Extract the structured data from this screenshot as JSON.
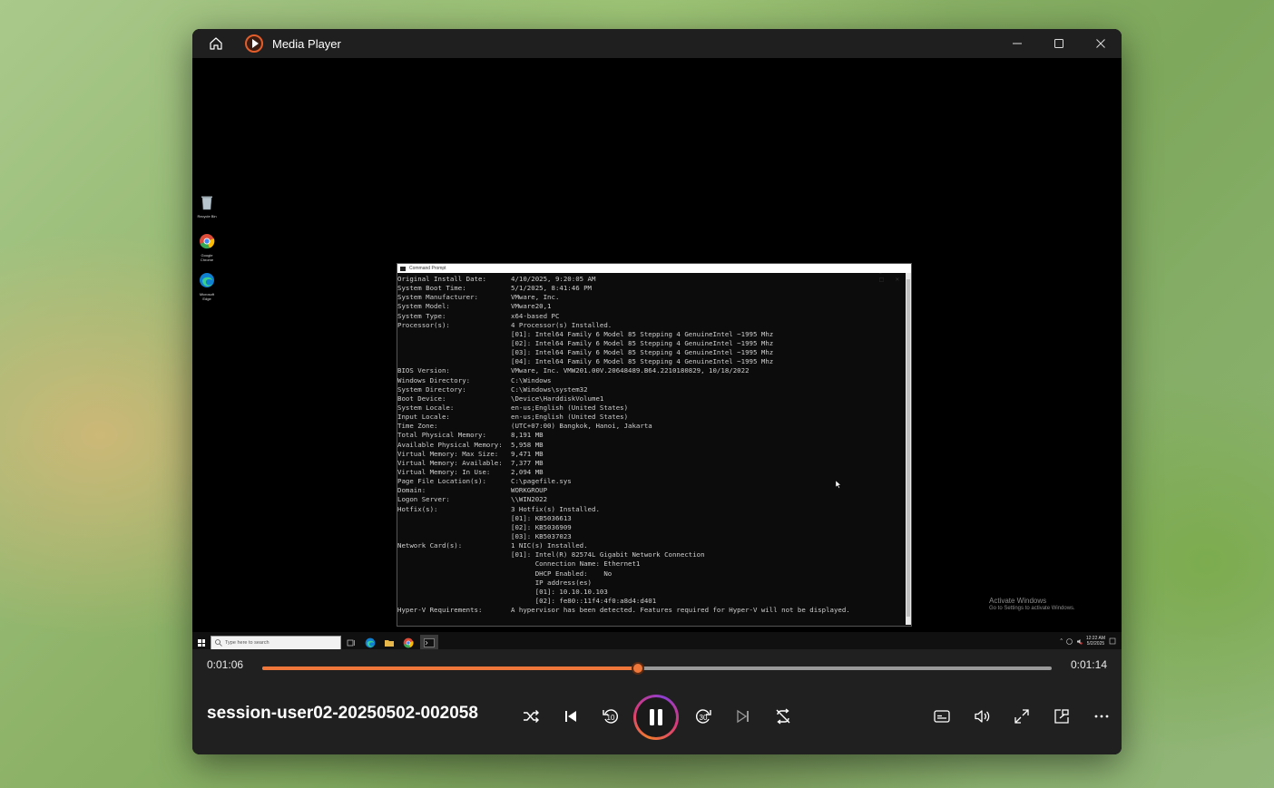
{
  "window": {
    "title": "Media Player"
  },
  "desktop": {
    "icons": [
      {
        "label": "Recycle Bin"
      },
      {
        "label": "Google Chrome"
      },
      {
        "label": "Microsoft Edge"
      }
    ],
    "cmd": {
      "title": "Command Prompt",
      "lines": [
        {
          "k": "Original Install Date:",
          "v": "4/10/2025, 9:20:05 AM"
        },
        {
          "k": "System Boot Time:",
          "v": "5/1/2025, 8:41:46 PM"
        },
        {
          "k": "System Manufacturer:",
          "v": "VMware, Inc."
        },
        {
          "k": "System Model:",
          "v": "VMware20,1"
        },
        {
          "k": "System Type:",
          "v": "x64-based PC"
        },
        {
          "k": "Processor(s):",
          "v": "4 Processor(s) Installed."
        },
        {
          "k": "",
          "v": "[01]: Intel64 Family 6 Model 85 Stepping 4 GenuineIntel ~1995 Mhz"
        },
        {
          "k": "",
          "v": "[02]: Intel64 Family 6 Model 85 Stepping 4 GenuineIntel ~1995 Mhz"
        },
        {
          "k": "",
          "v": "[03]: Intel64 Family 6 Model 85 Stepping 4 GenuineIntel ~1995 Mhz"
        },
        {
          "k": "",
          "v": "[04]: Intel64 Family 6 Model 85 Stepping 4 GenuineIntel ~1995 Mhz"
        },
        {
          "k": "BIOS Version:",
          "v": "VMware, Inc. VMW201.00V.20648489.B64.2210180829, 10/18/2022"
        },
        {
          "k": "Windows Directory:",
          "v": "C:\\Windows"
        },
        {
          "k": "System Directory:",
          "v": "C:\\Windows\\system32"
        },
        {
          "k": "Boot Device:",
          "v": "\\Device\\HarddiskVolume1"
        },
        {
          "k": "System Locale:",
          "v": "en-us;English (United States)"
        },
        {
          "k": "Input Locale:",
          "v": "en-us;English (United States)"
        },
        {
          "k": "Time Zone:",
          "v": "(UTC+07:00) Bangkok, Hanoi, Jakarta"
        },
        {
          "k": "Total Physical Memory:",
          "v": "8,191 MB"
        },
        {
          "k": "Available Physical Memory:",
          "v": "5,958 MB"
        },
        {
          "k": "Virtual Memory: Max Size:",
          "v": "9,471 MB"
        },
        {
          "k": "Virtual Memory: Available:",
          "v": "7,377 MB"
        },
        {
          "k": "Virtual Memory: In Use:",
          "v": "2,094 MB"
        },
        {
          "k": "Page File Location(s):",
          "v": "C:\\pagefile.sys"
        },
        {
          "k": "Domain:",
          "v": "WORKGROUP"
        },
        {
          "k": "Logon Server:",
          "v": "\\\\WIN2022"
        },
        {
          "k": "Hotfix(s):",
          "v": "3 Hotfix(s) Installed."
        },
        {
          "k": "",
          "v": "[01]: KB5036613"
        },
        {
          "k": "",
          "v": "[02]: KB5036909"
        },
        {
          "k": "",
          "v": "[03]: KB5037023"
        },
        {
          "k": "Network Card(s):",
          "v": "1 NIC(s) Installed."
        },
        {
          "k": "",
          "v": "[01]: Intel(R) 82574L Gigabit Network Connection"
        },
        {
          "k": "",
          "v": "      Connection Name: Ethernet1"
        },
        {
          "k": "",
          "v": "      DHCP Enabled:    No"
        },
        {
          "k": "",
          "v": "      IP address(es)"
        },
        {
          "k": "",
          "v": "      [01]: 10.10.10.103"
        },
        {
          "k": "",
          "v": "      [02]: fe80::11f4:4f0:a8d4:d401"
        },
        {
          "k": "Hyper-V Requirements:",
          "v": "A hypervisor has been detected. Features required for Hyper-V will not be displayed."
        }
      ]
    },
    "activate": {
      "line1": "Activate Windows",
      "line2": "Go to Settings to activate Windows."
    },
    "taskbar": {
      "search_placeholder": "Type here to search",
      "clock_time": "12:22 AM",
      "clock_date": "5/2/2025"
    }
  },
  "player": {
    "current_time": "0:01:06",
    "total_time": "0:01:14",
    "progress": 0.4757,
    "video_title": "session-user02-20250502-002058"
  },
  "colors": {
    "accent": "#f0773a",
    "titlebar": "#1f1f1f",
    "controls": "#202020"
  }
}
